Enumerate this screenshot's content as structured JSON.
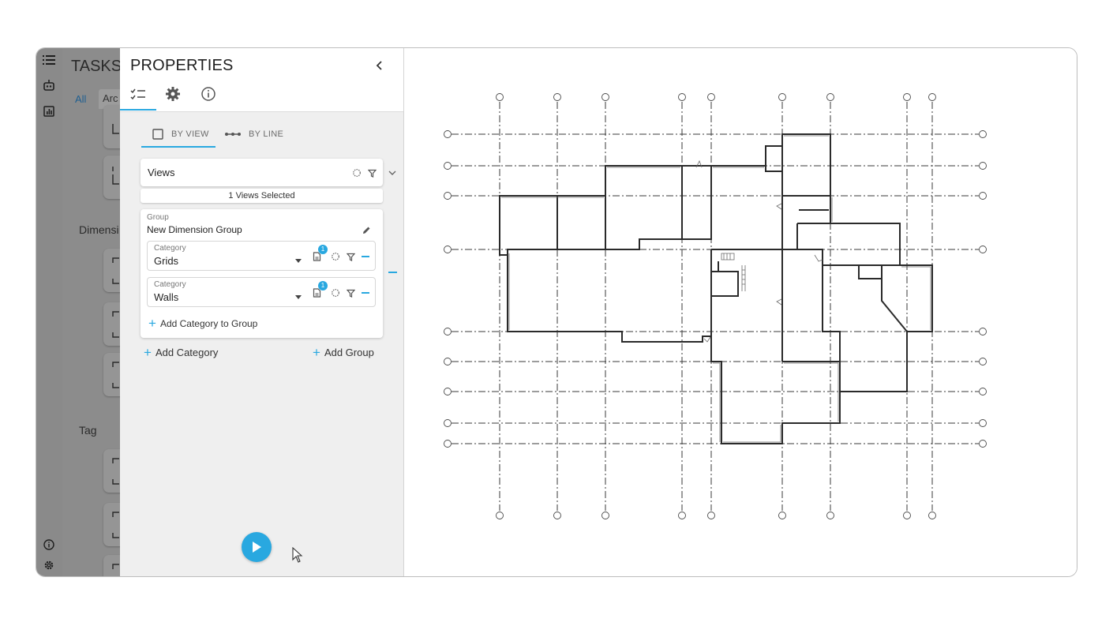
{
  "tasks_panel": {
    "title": "TASKS",
    "tabs": [
      {
        "label": "All",
        "active": true
      },
      {
        "label": "Arc",
        "active": false
      }
    ],
    "sections": [
      "Dimensi",
      "Tag"
    ]
  },
  "properties_panel": {
    "title": "PROPERTIES",
    "header_tabs": [
      "checklist-icon",
      "gear-icon",
      "info-icon"
    ],
    "mode_tabs": [
      {
        "label": "BY VIEW",
        "active": true
      },
      {
        "label": "BY LINE",
        "active": false
      }
    ],
    "views": {
      "label": "Views",
      "selected_text": "1 Views Selected"
    },
    "group": {
      "caption": "Group",
      "name": "New Dimension Group",
      "categories": [
        {
          "caption": "Category",
          "value": "Grids",
          "badge": "1"
        },
        {
          "caption": "Category",
          "value": "Walls",
          "badge": "1"
        }
      ],
      "add_category_to_group": "Add Category to Group"
    },
    "add_category": "Add Category",
    "add_group": "Add Group"
  },
  "colors": {
    "accent": "#29a8e0",
    "rail": "#8a8a8a",
    "panel_bg": "#efefef"
  }
}
